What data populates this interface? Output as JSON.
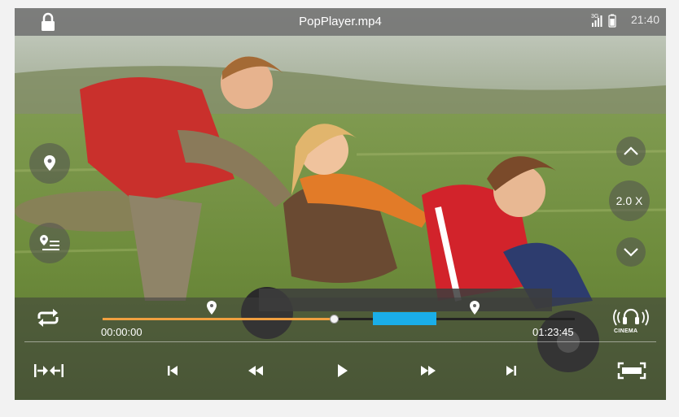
{
  "app": {
    "title": "PopPlayer.mp4",
    "clock": "21:40",
    "network": "3G"
  },
  "side_controls": {
    "speed_label": "2.0 X"
  },
  "player": {
    "current_time": "00:00:00",
    "total_time": "01:23:45",
    "progress": 0.49,
    "cinema_label": "CINEMA"
  },
  "colors": {
    "played": "#f0a040",
    "ab_segment": "#1aaee8"
  }
}
